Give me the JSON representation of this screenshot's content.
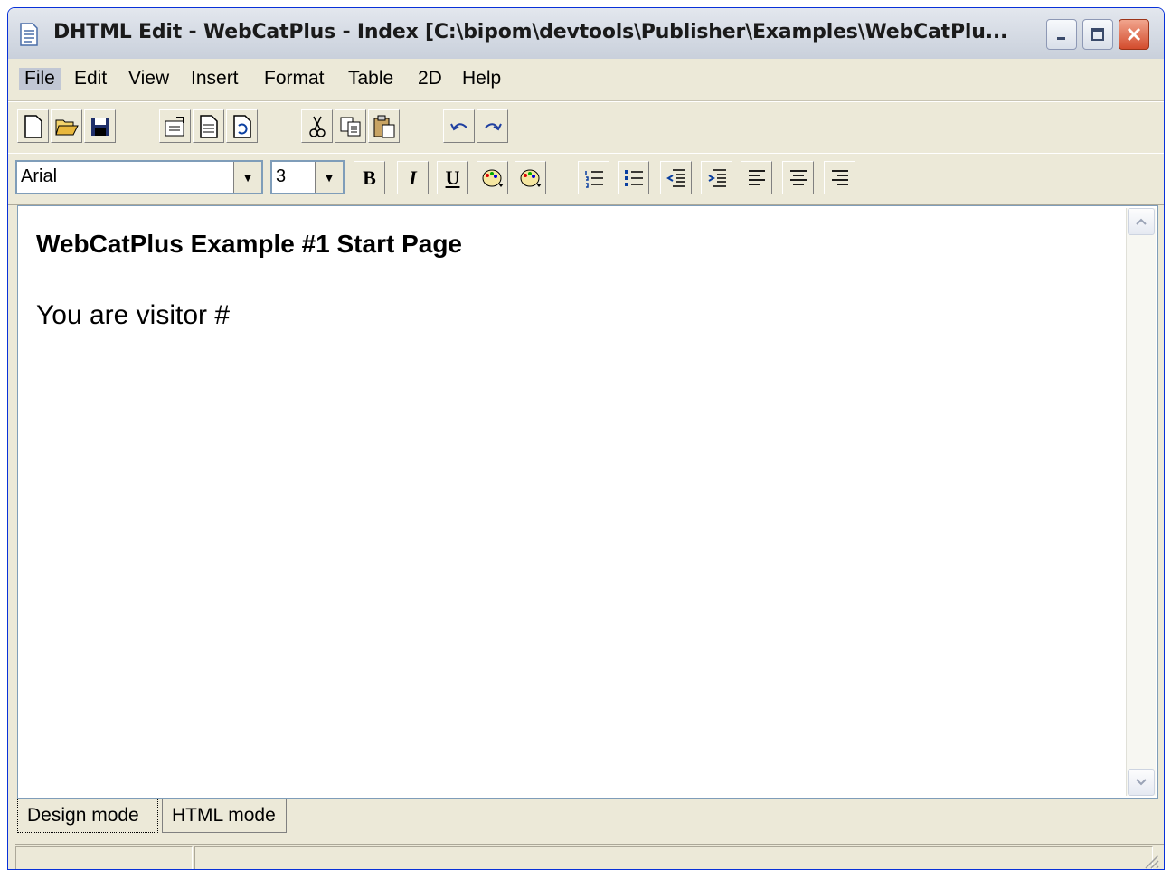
{
  "window": {
    "title": "DHTML Edit - WebCatPlus - Index [C:\\bipom\\devtools\\Publisher\\Examples\\WebCatPlu...",
    "minimize_label": "minimize",
    "maximize_label": "maximize",
    "close_label": "close"
  },
  "menu": {
    "items": [
      "File",
      "Edit",
      "View",
      "Insert",
      "Format",
      "Table",
      "2D",
      "Help"
    ]
  },
  "toolbar1": {
    "icons": [
      "new-icon",
      "open-icon",
      "save-icon",
      "properties-icon",
      "page-icon",
      "refresh-icon",
      "cut-icon",
      "copy-icon",
      "paste-icon",
      "undo-icon",
      "redo-icon"
    ]
  },
  "toolbar2": {
    "font": "Arial",
    "size": "3",
    "bold": "B",
    "italic": "I",
    "underline": "U"
  },
  "document": {
    "heading": "WebCatPlus Example #1 Start Page",
    "text": "You are visitor #"
  },
  "tabs": [
    "Design mode",
    "HTML mode"
  ],
  "colors": {
    "title_bar": "#d6dbe5",
    "close_button": "#d34c2d",
    "chrome": "#ece9d8"
  }
}
